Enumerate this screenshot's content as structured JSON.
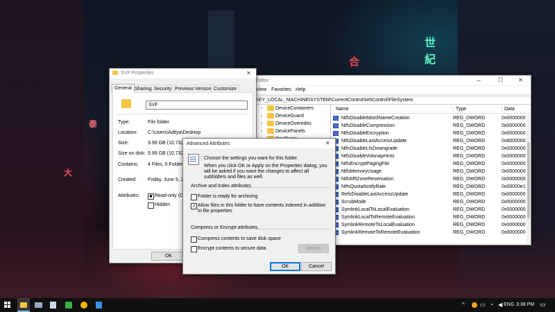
{
  "wallpaper": {
    "signs": [
      "世",
      "紀",
      "合",
      "泰",
      "大"
    ]
  },
  "svf_properties": {
    "title": "SVF Properties",
    "tabs": [
      "General",
      "Sharing",
      "Security",
      "Previous Versions",
      "Customize"
    ],
    "name_value": "SVF",
    "rows": [
      {
        "label": "Type:",
        "value": "File folder"
      },
      {
        "label": "Location:",
        "value": "C:\\Users\\Aditya\\Desktop"
      },
      {
        "label": "Size:",
        "value": "9.99 GB (10,732,3"
      },
      {
        "label": "Size on disk:",
        "value": "9.99 GB (10,732,3"
      },
      {
        "label": "Contains:",
        "value": "4 Files, 0 Folders"
      },
      {
        "label": "Created:",
        "value": "Friday, June 5, 20"
      },
      {
        "label": "Attributes:",
        "value": ""
      }
    ],
    "readonly_label": "Read-only (Onl",
    "hidden_label": "Hidden",
    "ok_label": "OK"
  },
  "registry": {
    "title": "Editor",
    "menu": [
      "View",
      "Favorites",
      "Help"
    ],
    "address": "KEY_LOCAL_MACHINE\\SYSTEM\\CurrentControlSet\\Control\\FileSystem",
    "tree": [
      "DeviceContainers",
      "DeviceGuard",
      "DeviceOverrides",
      "DevicePanels",
      "DevQuery"
    ],
    "columns": [
      "Name",
      "Type",
      "Data"
    ],
    "values": [
      {
        "name": "NtfsDisable8dot3NameCreation",
        "type": "REG_DWORD",
        "data": "0x0000000"
      },
      {
        "name": "NtfsDisableCompression",
        "type": "REG_DWORD",
        "data": "0x0000000"
      },
      {
        "name": "NtfsDisableEncryption",
        "type": "REG_DWORD",
        "data": "0x0000000"
      },
      {
        "name": "NtfsDisableLastAccessUpdate",
        "type": "REG_DWORD",
        "data": "0x8000000"
      },
      {
        "name": "NtfsDisableLfsDowngrade",
        "type": "REG_DWORD",
        "data": "0x0000000"
      },
      {
        "name": "NtfsDisableVolsnapHints",
        "type": "REG_DWORD",
        "data": "0x0000000"
      },
      {
        "name": "NtfsEncryptPagingFile",
        "type": "REG_DWORD",
        "data": "0x0000000"
      },
      {
        "name": "NtfsMemoryUsage",
        "type": "REG_DWORD",
        "data": "0x0000000"
      },
      {
        "name": "NtfsMftZoneReservation",
        "type": "REG_DWORD",
        "data": "0x0000000"
      },
      {
        "name": "NtfsQuotaNotifyRate",
        "type": "REG_DWORD",
        "data": "0x00000e1"
      },
      {
        "name": "RefsDisableLastAccessUpdate",
        "type": "REG_DWORD",
        "data": "0x0000000"
      },
      {
        "name": "ScrubMode",
        "type": "REG_DWORD",
        "data": "0x0000000"
      },
      {
        "name": "SymlinkLocalToLocalEvaluation",
        "type": "REG_DWORD",
        "data": "0x0000000"
      },
      {
        "name": "SymlinkLocalToRemoteEvaluation",
        "type": "REG_DWORD",
        "data": "0x0000000"
      },
      {
        "name": "SymlinkRemoteToLocalEvaluation",
        "type": "REG_DWORD",
        "data": "0x0000000"
      },
      {
        "name": "SymlinkRemoteToRemoteEvaluation",
        "type": "REG_DWORD",
        "data": "0x0000000"
      }
    ]
  },
  "advanced": {
    "title": "Advanced Attributes",
    "intro": "Choose the settings you want for this folder.",
    "intro2": "When you click OK or Apply on the Properties dialog, you will be asked if you want the changes to affect all subfolders and files as well.",
    "archive_heading": "Archive and Index attributes",
    "archive_label": "Folder is ready for archiving",
    "index_label": "Allow files in this folder to have contents indexed in addition to file properties",
    "compress_heading": "Compress or Encrypt attributes",
    "compress_label": "Compress contents to save disk space",
    "encrypt_label": "Encrypt contents to secure data",
    "details_label": "Details",
    "ok_label": "OK",
    "cancel_label": "Cancel",
    "archive_checked": false,
    "index_checked": true,
    "compress_checked": false,
    "encrypt_checked": false
  },
  "taskbar": {
    "time": "3:38 PM",
    "language": "ENG"
  }
}
